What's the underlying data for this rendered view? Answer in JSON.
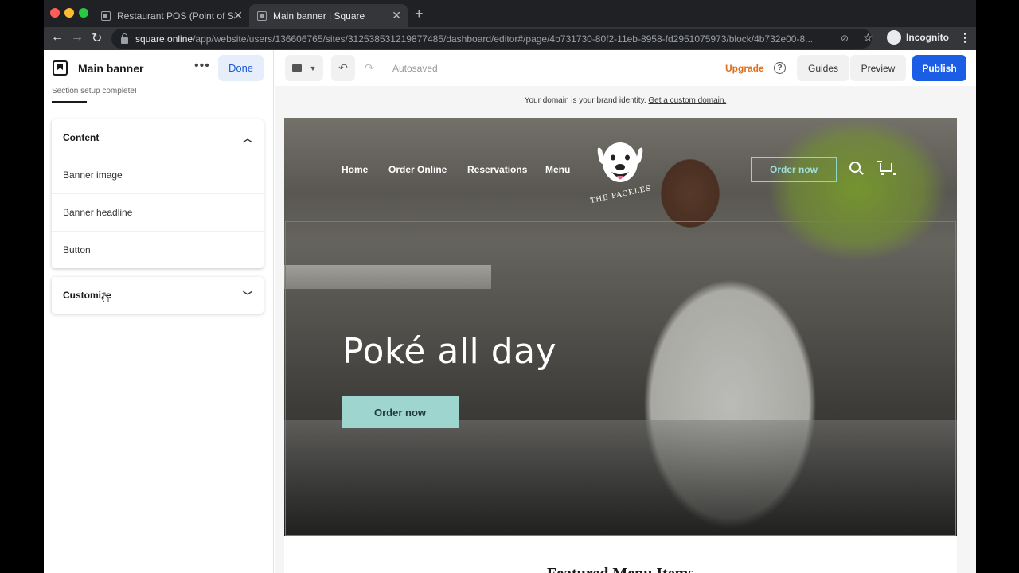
{
  "browser": {
    "tabs": [
      {
        "title": "Restaurant POS (Point of Sale)",
        "active": false
      },
      {
        "title": "Main banner | Square",
        "active": true
      }
    ],
    "new_tab_icon": "plus-icon",
    "url_domain": "square.online",
    "url_path": "/app/website/users/136606765/sites/312538531219877485/dashboard/editor#/page/4b731730-80f2-11eb-8958-fd2951075973/block/4b732e00-8...",
    "profile_label": "Incognito"
  },
  "left_panel": {
    "title": "Main banner",
    "done_label": "Done",
    "status": "Section setup complete!",
    "content_section": {
      "label": "Content",
      "items": [
        "Banner image",
        "Banner headline",
        "Button"
      ]
    },
    "customize_section": {
      "label": "Customize"
    }
  },
  "toolbar": {
    "autosave_status": "Autosaved",
    "upgrade_label": "Upgrade",
    "help_label": "?",
    "guides_label": "Guides",
    "preview_label": "Preview",
    "publish_label": "Publish"
  },
  "domain_note": {
    "text": "Your domain is your brand identity.",
    "link": "Get a custom domain."
  },
  "site": {
    "nav": [
      "Home",
      "Order Online",
      "Reservations",
      "Menu"
    ],
    "logo_text": "THE PACKLES",
    "nav_cta": "Order now",
    "headline": "Poké all day",
    "hero_button": "Order now",
    "next_section_title": "Featured Menu Items"
  },
  "colors": {
    "accent": "#1b5ee5",
    "upgrade": "#e06f1d",
    "hero_button": "#9ed6cf",
    "selection": "#4a7cf0"
  }
}
